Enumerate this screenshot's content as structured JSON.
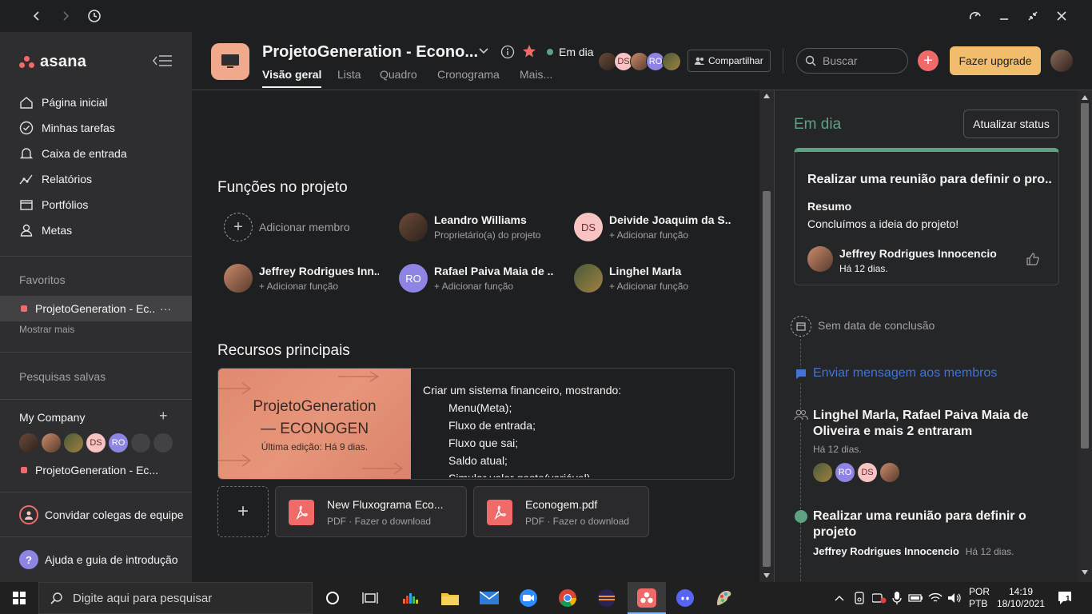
{
  "window": {
    "controls": [
      "back",
      "forward",
      "history",
      "assistant",
      "minimize",
      "restore",
      "close"
    ]
  },
  "sidebar": {
    "brand": "asana",
    "nav": [
      {
        "label": "Página inicial",
        "icon": "home-icon"
      },
      {
        "label": "Minhas tarefas",
        "icon": "check-circle-icon"
      },
      {
        "label": "Caixa de entrada",
        "icon": "bell-icon"
      },
      {
        "label": "Relatórios",
        "icon": "chart-icon"
      },
      {
        "label": "Portfólios",
        "icon": "folder-icon"
      },
      {
        "label": "Metas",
        "icon": "person-icon"
      }
    ],
    "favorites_label": "Favoritos",
    "favorite_project": "ProjetoGeneration - Ec...",
    "favorite_more": "···",
    "show_more": "Mostrar mais",
    "saved_searches": "Pesquisas salvas",
    "team_label": "My Company",
    "team_add": "+",
    "team_avatars": [
      "DS",
      "RO"
    ],
    "team_project": "ProjetoGeneration - Ec...",
    "invite": "Convidar colegas de equipe",
    "help": "Ajuda e guia de introdução",
    "help_badge": "?"
  },
  "header": {
    "title": "ProjetoGeneration - Econo...",
    "status": "Em dia",
    "tabs": [
      "Visão geral",
      "Lista",
      "Quadro",
      "Cronograma",
      "Mais..."
    ],
    "avatars": [
      "DS",
      "RO"
    ],
    "share": "Compartilhar",
    "search_placeholder": "Buscar",
    "upgrade": "Fazer upgrade",
    "plus": "+"
  },
  "main": {
    "roles_title": "Funções no projeto",
    "add_member": "Adicionar membro",
    "members": [
      {
        "name": "Leandro Williams",
        "role": "Proprietário(a) do projeto",
        "initials": ""
      },
      {
        "name": "Deivide Joaquim da S...",
        "role": "+ Adicionar função",
        "initials": "DS"
      },
      {
        "name": "Jeffrey Rodrigues Inn...",
        "role": "+ Adicionar função",
        "initials": ""
      },
      {
        "name": "Rafael Paiva Maia de ...",
        "role": "+ Adicionar função",
        "initials": "RO"
      },
      {
        "name": "Linghel Marla",
        "role": "+ Adicionar função",
        "initials": ""
      }
    ],
    "resources_title": "Recursos principais",
    "brief": {
      "title_line1": "ProjetoGeneration",
      "title_line2": "— ECONOGEN",
      "edited": "Última edição: Há 9 dias.",
      "lines": [
        "Criar um sistema financeiro, mostrando:",
        "Menu(Meta);",
        "Fluxo de entrada;",
        "Fluxo que sai;",
        "Saldo atual;",
        "Simular valor gasto(variável)."
      ]
    },
    "add_resource": "+",
    "files": [
      {
        "name": "New Fluxograma Eco...",
        "meta": "PDF · Fazer o download"
      },
      {
        "name": "Econogem.pdf",
        "meta": "PDF · Fazer o download"
      }
    ]
  },
  "right": {
    "status_title": "Em dia",
    "update_btn": "Atualizar status",
    "card": {
      "title": "Realizar uma reunião para definir o pro...",
      "summary_label": "Resumo",
      "summary": "Concluímos a ideia do projeto!",
      "author": "Jeffrey Rodrigues Innocencio",
      "time": "Há 12 dias."
    },
    "due": "Sem data de conclusão",
    "message": "Enviar mensagem aos membros",
    "joined": "Linghel Marla, Rafael Paiva Maia de Oliveira e mais 2 entraram",
    "joined_time": "Há 12 dias.",
    "joined_avatars": [
      "RO",
      "DS"
    ],
    "milestone": "Realizar uma reunião para definir o projeto",
    "milestone_author": "Jeffrey Rodrigues Innocencio",
    "milestone_time": "Há 12 dias."
  },
  "taskbar": {
    "search": "Digite aqui para pesquisar",
    "lang1": "POR",
    "lang2": "PTB",
    "time": "14:19",
    "date": "18/10/2021",
    "notif": "1"
  },
  "colors": {
    "accent": "#f06a6a",
    "green": "#5da283",
    "upgrade": "#f1bd6c",
    "project": "#f1a98c"
  }
}
